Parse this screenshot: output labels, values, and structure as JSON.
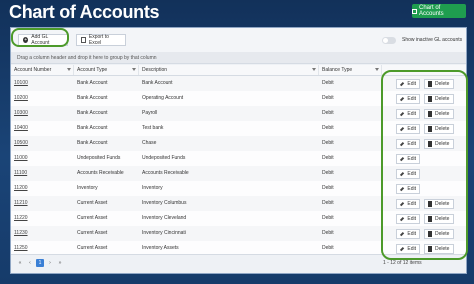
{
  "page_title": "Chart of Accounts",
  "top_button_label": "Chart of Accounts",
  "toolbar": {
    "add_label": "Add GL Account",
    "export_label": "Export to Excel",
    "toggle_label": "Show inactive GL accounts"
  },
  "group_hint": "Drag a column header and drop it here to group by that column",
  "columns": [
    "Account Number",
    "Account Type",
    "Description",
    "Balance Type"
  ],
  "actions": {
    "edit_label": "Edit",
    "delete_label": "Delete"
  },
  "rows": [
    {
      "number": "10100",
      "type": "Bank Account",
      "description": "Bank Account",
      "balance": "Debit",
      "delete": true
    },
    {
      "number": "10200",
      "type": "Bank Account",
      "description": "Operating Account",
      "balance": "Debit",
      "delete": true
    },
    {
      "number": "10300",
      "type": "Bank Account",
      "description": "Payroll",
      "balance": "Debit",
      "delete": true
    },
    {
      "number": "10400",
      "type": "Bank Account",
      "description": "Test bank",
      "balance": "Debit",
      "delete": true
    },
    {
      "number": "10500",
      "type": "Bank Account",
      "description": "Chase",
      "balance": "Debit",
      "delete": true
    },
    {
      "number": "11000",
      "type": "Undeposited Funds",
      "description": "Undeposited Funds",
      "balance": "Debit",
      "delete": false
    },
    {
      "number": "11100",
      "type": "Accounts Receivable",
      "description": "Accounts Receivable",
      "balance": "Debit",
      "delete": false
    },
    {
      "number": "11200",
      "type": "Inventory",
      "description": "Inventory",
      "balance": "Debit",
      "delete": false
    },
    {
      "number": "11210",
      "type": "Current Asset",
      "description": "Inventory Columbus",
      "balance": "Debit",
      "delete": true
    },
    {
      "number": "11220",
      "type": "Current Asset",
      "description": "Inventory Cleveland",
      "balance": "Debit",
      "delete": true
    },
    {
      "number": "11230",
      "type": "Current Asset",
      "description": "Inventory Cincinnati",
      "balance": "Debit",
      "delete": true
    },
    {
      "number": "11250",
      "type": "Current Asset",
      "description": "Inventory Assets",
      "balance": "Debit",
      "delete": true
    }
  ],
  "pager": {
    "pages": [
      "«",
      "‹",
      "1",
      "›",
      "»"
    ],
    "active": "1",
    "info": "1 - 12 of 12 items"
  }
}
